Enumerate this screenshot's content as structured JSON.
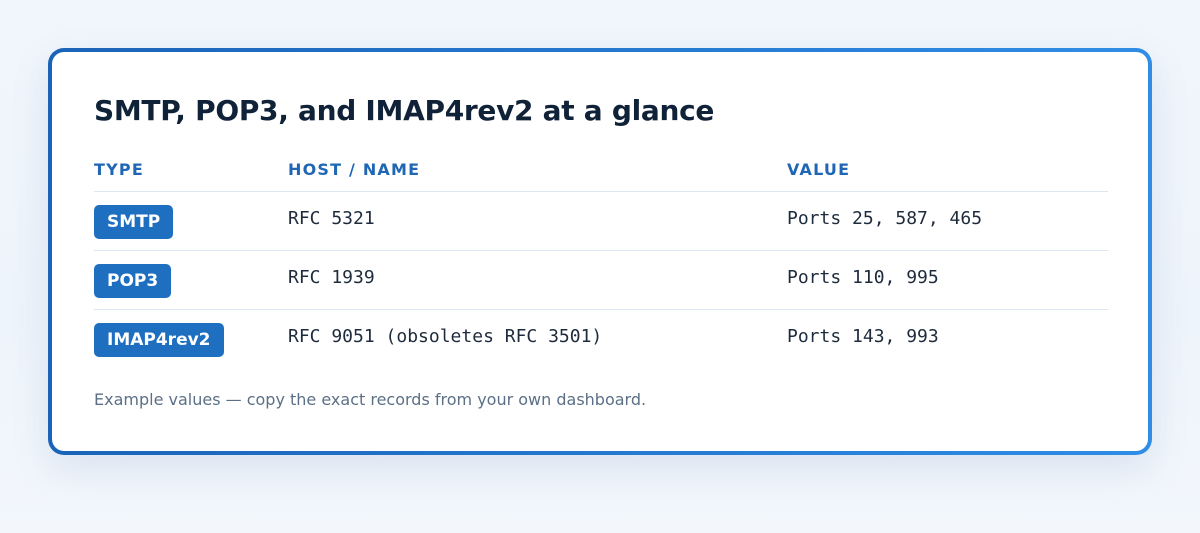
{
  "card": {
    "title": "SMTP, POP3, and IMAP4rev2 at a glance",
    "columns": [
      "TYPE",
      "HOST / NAME",
      "VALUE"
    ],
    "rows": [
      {
        "type": "SMTP",
        "host": "RFC 5321",
        "value": "Ports 25, 587, 465"
      },
      {
        "type": "POP3",
        "host": "RFC 1939",
        "value": "Ports 110, 995"
      },
      {
        "type": "IMAP4rev2",
        "host": "RFC 9051 (obsoletes RFC 3501)",
        "value": "Ports 143, 993"
      }
    ],
    "note": "Example values — copy the exact records from your own dashboard."
  },
  "colors": {
    "accent": "#1f6fc1",
    "header_text": "#1f66b4",
    "border_gradient_start": "#1a63b8",
    "border_gradient_end": "#2f8de6",
    "title_text": "#0f2238",
    "note_text": "#5b6f86"
  }
}
